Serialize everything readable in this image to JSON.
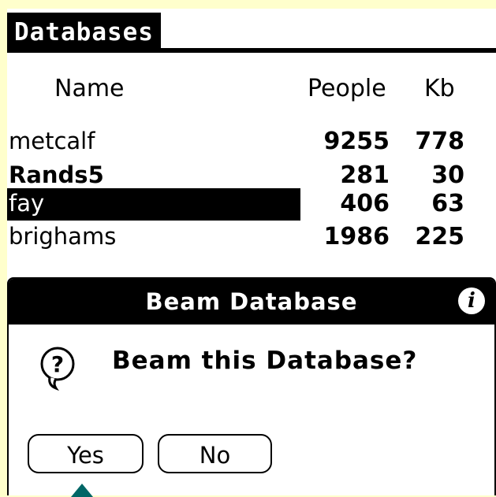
{
  "title": "Databases",
  "columns": {
    "name": "Name",
    "people": "People",
    "kb": "Kb"
  },
  "rows": [
    {
      "name": "metcalf",
      "people": "9255",
      "kb": "778",
      "bold": false,
      "selected": false
    },
    {
      "name": "Rands5",
      "people": "281",
      "kb": "30",
      "bold": true,
      "selected": false
    },
    {
      "name": "fay",
      "people": "406",
      "kb": "63",
      "bold": false,
      "selected": true
    },
    {
      "name": "brighams",
      "people": "1986",
      "kb": "225",
      "bold": false,
      "selected": false
    }
  ],
  "dialog": {
    "title": "Beam Database",
    "message": "Beam this Database?",
    "yes_label": "Yes",
    "no_label": "No",
    "info_icon": "i"
  },
  "colors": {
    "page_background": "#ffffcc",
    "cursor_marker": "#006666"
  }
}
